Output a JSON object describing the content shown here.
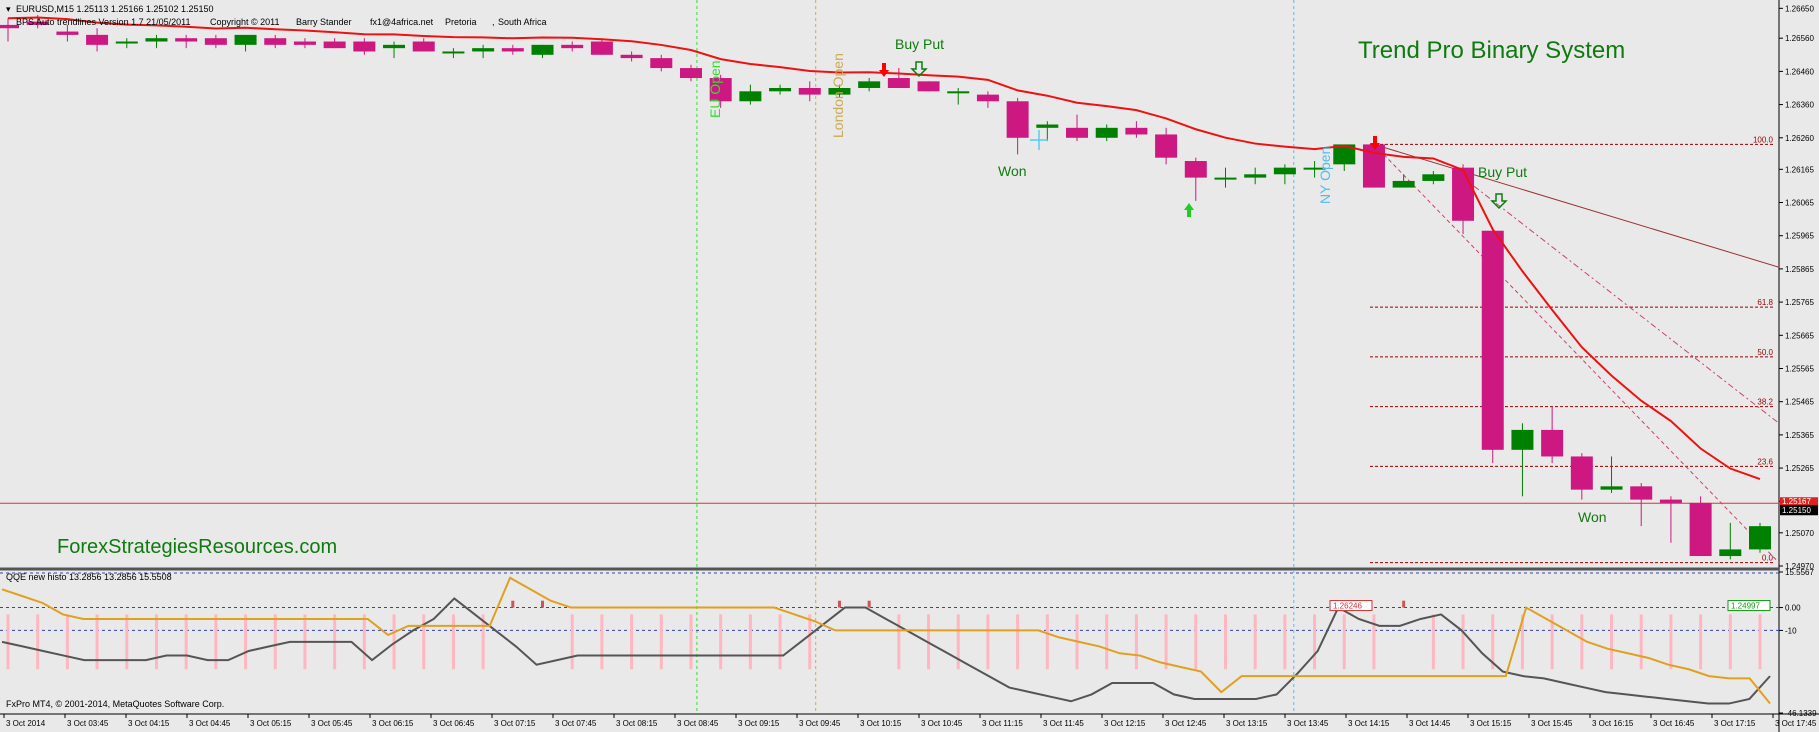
{
  "header": {
    "symbol_line": "EURUSD,M15  1.25113 1.25166 1.25102 1.25150",
    "indicator_line": "BPS Auto trendlines Version 1.7  21/05/2011",
    "copyright": "Copyright © 2011",
    "author": "Barry Stander",
    "email": "fx1@4africa.net",
    "city": "Pretoria",
    "country": "South Africa"
  },
  "titles": {
    "system": "Trend Pro Binary System",
    "website": "ForexStrategiesResources.com",
    "broker": "FxPro MT4, © 2001-2014, MetaQuotes Software Corp."
  },
  "annotations": {
    "buy_put_1": "Buy Put",
    "buy_put_2": "Buy Put",
    "won_1": "Won",
    "won_2": "Won",
    "eu_open": "EU Open",
    "london_open": "London Open",
    "ny_open": "NY Open"
  },
  "colors": {
    "bull": "#008000",
    "bear": "#cc1880",
    "ma": "#ee1111",
    "eu_line": "#33dd33",
    "london_line": "#ccaa55",
    "ny_line": "#55bbee",
    "fib": "#990000",
    "qqe_fast": "#e0a020",
    "qqe_slow": "#555555",
    "histo": "#ffb6c1"
  },
  "chart_data": [
    {
      "type": "candlestick",
      "ylim": [
        1.2497,
        1.2666
      ],
      "price_ticks": [
        "1.26650",
        "1.26560",
        "1.26460",
        "1.26360",
        "1.26260",
        "1.26165",
        "1.26065",
        "1.25965",
        "1.25865",
        "1.25765",
        "1.25665",
        "1.25565",
        "1.25465",
        "1.25365",
        "1.25265",
        "1.25165",
        "1.25070",
        "1.24970"
      ],
      "current_price": "1.25150",
      "current_price_hidden_tag": "1.25167",
      "fib_levels": [
        {
          "label": "100.0",
          "price": 1.2624
        },
        {
          "label": "61.8",
          "price": 1.2575
        },
        {
          "label": "50.0",
          "price": 1.256
        },
        {
          "label": "38.2",
          "price": 1.2545
        },
        {
          "label": "23.6",
          "price": 1.2527
        },
        {
          "label": "0.0",
          "price": 1.2498
        }
      ],
      "time_labels": [
        "3 Oct 2014",
        "3 Oct 03:45",
        "3 Oct 04:15",
        "3 Oct 04:45",
        "3 Oct 05:15",
        "3 Oct 05:45",
        "3 Oct 06:15",
        "3 Oct 06:45",
        "3 Oct 07:15",
        "3 Oct 07:45",
        "3 Oct 08:15",
        "3 Oct 08:45",
        "3 Oct 09:15",
        "3 Oct 09:45",
        "3 Oct 10:15",
        "3 Oct 10:45",
        "3 Oct 11:15",
        "3 Oct 11:45",
        "3 Oct 12:15",
        "3 Oct 12:45",
        "3 Oct 13:15",
        "3 Oct 13:45",
        "3 Oct 14:15",
        "3 Oct 14:45",
        "3 Oct 15:15",
        "3 Oct 15:45",
        "3 Oct 16:15",
        "3 Oct 16:45",
        "3 Oct 17:15",
        "3 Oct 17:45"
      ],
      "candles": [
        {
          "o": 1.266,
          "h": 1.2662,
          "l": 1.2655,
          "c": 1.2659
        },
        {
          "o": 1.2661,
          "h": 1.2663,
          "l": 1.2659,
          "c": 1.266
        },
        {
          "o": 1.2658,
          "h": 1.266,
          "l": 1.2655,
          "c": 1.2657
        },
        {
          "o": 1.2657,
          "h": 1.2659,
          "l": 1.2652,
          "c": 1.2654
        },
        {
          "o": 1.2655,
          "h": 1.2656,
          "l": 1.2653,
          "c": 1.2655
        },
        {
          "o": 1.2655,
          "h": 1.2657,
          "l": 1.2653,
          "c": 1.2656
        },
        {
          "o": 1.2656,
          "h": 1.2657,
          "l": 1.2653,
          "c": 1.2655
        },
        {
          "o": 1.2656,
          "h": 1.2657,
          "l": 1.2653,
          "c": 1.2654
        },
        {
          "o": 1.2654,
          "h": 1.2657,
          "l": 1.2652,
          "c": 1.2657
        },
        {
          "o": 1.2656,
          "h": 1.2657,
          "l": 1.2653,
          "c": 1.2654
        },
        {
          "o": 1.2655,
          "h": 1.2656,
          "l": 1.2653,
          "c": 1.2654
        },
        {
          "o": 1.2655,
          "h": 1.2656,
          "l": 1.2653,
          "c": 1.2653
        },
        {
          "o": 1.2655,
          "h": 1.2656,
          "l": 1.2651,
          "c": 1.2652
        },
        {
          "o": 1.2653,
          "h": 1.2655,
          "l": 1.265,
          "c": 1.2654
        },
        {
          "o": 1.2655,
          "h": 1.2656,
          "l": 1.2652,
          "c": 1.2652
        },
        {
          "o": 1.2652,
          "h": 1.2653,
          "l": 1.265,
          "c": 1.2652
        },
        {
          "o": 1.2652,
          "h": 1.2654,
          "l": 1.265,
          "c": 1.2653
        },
        {
          "o": 1.2653,
          "h": 1.2654,
          "l": 1.2651,
          "c": 1.2652
        },
        {
          "o": 1.2651,
          "h": 1.2654,
          "l": 1.265,
          "c": 1.2654
        },
        {
          "o": 1.2654,
          "h": 1.2655,
          "l": 1.2652,
          "c": 1.2653
        },
        {
          "o": 1.2655,
          "h": 1.2656,
          "l": 1.2651,
          "c": 1.2651
        },
        {
          "o": 1.2651,
          "h": 1.2652,
          "l": 1.2649,
          "c": 1.265
        },
        {
          "o": 1.265,
          "h": 1.2651,
          "l": 1.2646,
          "c": 1.2647
        },
        {
          "o": 1.2647,
          "h": 1.2648,
          "l": 1.2643,
          "c": 1.2644
        },
        {
          "o": 1.2644,
          "h": 1.2645,
          "l": 1.2635,
          "c": 1.2637
        },
        {
          "o": 1.2637,
          "h": 1.2642,
          "l": 1.2636,
          "c": 1.264
        },
        {
          "o": 1.264,
          "h": 1.2642,
          "l": 1.2639,
          "c": 1.2641
        },
        {
          "o": 1.2641,
          "h": 1.2643,
          "l": 1.2637,
          "c": 1.2639
        },
        {
          "o": 1.2639,
          "h": 1.2642,
          "l": 1.2638,
          "c": 1.2641
        },
        {
          "o": 1.2641,
          "h": 1.2644,
          "l": 1.264,
          "c": 1.2643
        },
        {
          "o": 1.2644,
          "h": 1.2647,
          "l": 1.2641,
          "c": 1.2641
        },
        {
          "o": 1.2643,
          "h": 1.2643,
          "l": 1.264,
          "c": 1.264
        },
        {
          "o": 1.264,
          "h": 1.2641,
          "l": 1.2636,
          "c": 1.264
        },
        {
          "o": 1.2639,
          "h": 1.264,
          "l": 1.2635,
          "c": 1.2637
        },
        {
          "o": 1.2637,
          "h": 1.2638,
          "l": 1.2621,
          "c": 1.2626
        },
        {
          "o": 1.2629,
          "h": 1.2631,
          "l": 1.2625,
          "c": 1.263
        },
        {
          "o": 1.2629,
          "h": 1.2633,
          "l": 1.2625,
          "c": 1.2626
        },
        {
          "o": 1.2626,
          "h": 1.263,
          "l": 1.2625,
          "c": 1.2629
        },
        {
          "o": 1.2629,
          "h": 1.2631,
          "l": 1.2626,
          "c": 1.2627
        },
        {
          "o": 1.2627,
          "h": 1.2629,
          "l": 1.2618,
          "c": 1.262
        },
        {
          "o": 1.2619,
          "h": 1.262,
          "l": 1.2607,
          "c": 1.2614
        },
        {
          "o": 1.2614,
          "h": 1.2617,
          "l": 1.2611,
          "c": 1.2614
        },
        {
          "o": 1.2614,
          "h": 1.2617,
          "l": 1.2612,
          "c": 1.2615
        },
        {
          "o": 1.2615,
          "h": 1.2618,
          "l": 1.2612,
          "c": 1.2617
        },
        {
          "o": 1.2617,
          "h": 1.2619,
          "l": 1.2614,
          "c": 1.2617
        },
        {
          "o": 1.2618,
          "h": 1.2624,
          "l": 1.2616,
          "c": 1.2624
        },
        {
          "o": 1.2624,
          "h": 1.2625,
          "l": 1.2611,
          "c": 1.2611
        },
        {
          "o": 1.2611,
          "h": 1.2615,
          "l": 1.2611,
          "c": 1.2613
        },
        {
          "o": 1.2613,
          "h": 1.2616,
          "l": 1.2612,
          "c": 1.2615
        },
        {
          "o": 1.2617,
          "h": 1.2618,
          "l": 1.2597,
          "c": 1.2601
        },
        {
          "o": 1.2598,
          "h": 1.2599,
          "l": 1.2528,
          "c": 1.2532
        },
        {
          "o": 1.2532,
          "h": 1.254,
          "l": 1.2518,
          "c": 1.2538
        },
        {
          "o": 1.2538,
          "h": 1.2545,
          "l": 1.2528,
          "c": 1.253
        },
        {
          "o": 1.253,
          "h": 1.2531,
          "l": 1.2517,
          "c": 1.252
        },
        {
          "o": 1.252,
          "h": 1.253,
          "l": 1.2519,
          "c": 1.2521
        },
        {
          "o": 1.2521,
          "h": 1.2522,
          "l": 1.2509,
          "c": 1.2517
        },
        {
          "o": 1.2517,
          "h": 1.2518,
          "l": 1.2504,
          "c": 1.2516
        },
        {
          "o": 1.2516,
          "h": 1.2518,
          "l": 1.25,
          "c": 1.25
        },
        {
          "o": 1.25,
          "h": 1.251,
          "l": 1.2499,
          "c": 1.2502
        },
        {
          "o": 1.2502,
          "h": 1.251,
          "l": 1.2501,
          "c": 1.2509
        }
      ]
    },
    {
      "type": "line",
      "indicator_label": "QQE new histo 13.2856 13.2856 15.5508",
      "ylim": [
        -46.1339,
        15.5567
      ],
      "ticks": [
        "15.5567",
        "0.00",
        "-10",
        "-46.1339"
      ],
      "flags": [
        "1.26246",
        "1.24997"
      ],
      "fast": [
        8,
        5,
        2,
        -3,
        -5,
        -5,
        -5,
        -5,
        -5,
        -5,
        -5,
        -5,
        -5,
        -5,
        -5,
        -5,
        -5,
        -5,
        -5,
        -12,
        -8,
        -8,
        -8,
        -8,
        -8,
        13,
        8,
        3,
        0,
        0,
        0,
        0,
        0,
        0,
        0,
        0,
        0,
        0,
        0,
        -3,
        -6,
        -10,
        -10,
        -10,
        -10,
        -10,
        -10,
        -10,
        -10,
        -10,
        -10,
        -10,
        -13,
        -15,
        -17,
        -20,
        -21,
        -24,
        -26,
        -28,
        -37,
        -30,
        -30,
        -30,
        -30,
        -30,
        -30,
        -30,
        -30,
        -30,
        -30,
        -30,
        -30,
        -30,
        -30,
        0,
        -5,
        -10,
        -15,
        -18,
        -20,
        -22,
        -25,
        -27,
        -30,
        -31,
        -31,
        -42
      ],
      "slow": [
        -15,
        -17,
        -19,
        -21,
        -23,
        -23,
        -23,
        -23,
        -21,
        -21,
        -23,
        -23,
        -19,
        -17,
        -15,
        -15,
        -15,
        -15,
        -23,
        -16,
        -10,
        -5,
        4,
        -3,
        -10,
        -17,
        -25,
        -23,
        -21,
        -21,
        -21,
        -21,
        -21,
        -21,
        -21,
        -21,
        -21,
        -21,
        -21,
        -14,
        -7,
        0,
        0,
        -5,
        -10,
        -15,
        -20,
        -25,
        -30,
        -35,
        -37,
        -39,
        -41,
        -38,
        -33,
        -33,
        -33,
        -38,
        -40,
        -40,
        -40,
        -40,
        -38,
        -29,
        -19,
        0,
        -5,
        -8,
        -8,
        -5,
        -3,
        -10,
        -20,
        -28,
        -30,
        -31,
        -33,
        -35,
        -37,
        -38,
        -39,
        -40,
        -41,
        -42,
        -42,
        -40,
        -30
      ],
      "histo": [
        1,
        1,
        1,
        1,
        1,
        1,
        1,
        1,
        1,
        1,
        1,
        1,
        1,
        1,
        1,
        1,
        1,
        1,
        1,
        1,
        1,
        1,
        1,
        1,
        1,
        1,
        1,
        1,
        1,
        1,
        1,
        1,
        1,
        1,
        1,
        1,
        1,
        1,
        1,
        1,
        1,
        1,
        1,
        1,
        1,
        1,
        1,
        1,
        1,
        1,
        1,
        1,
        1,
        1,
        1,
        1,
        1,
        1,
        1,
        1,
        1,
        1
      ]
    }
  ]
}
